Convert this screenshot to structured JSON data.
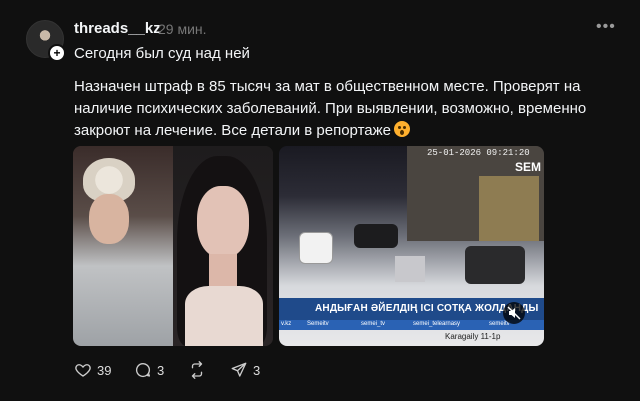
{
  "post": {
    "username": "threads__kz",
    "time": "29 мин.",
    "line1": "Сегодня был суд над ней",
    "body": "Назначен штраф в 85 тысяч за мат в общественном месте. Проверят на наличие психических заболеваний. При выявлении, возможно, временно закроют на лечение. Все детали в репортаже",
    "emoji": "astonished-face"
  },
  "media": {
    "video": {
      "timestamp": "25-01-2026 09:21:20",
      "channel_logo": "SEM",
      "headline": "АНДЫҒАН ӘЙЕЛДІҢ ІСІ СОТҚА ЖОЛДАНДЫ",
      "ticker": [
        "v.kz",
        "Semeitv",
        "semei_tv",
        "semei_telearnasy",
        "semeitv"
      ],
      "caption": "Karagaily 11-1p"
    }
  },
  "actions": {
    "likes": "39",
    "comments": "3",
    "reposts": "",
    "shares": "3"
  },
  "colors": {
    "background": "#101010",
    "text": "#f3f5f7",
    "muted": "#777777",
    "banner": "#1f4a8a"
  }
}
